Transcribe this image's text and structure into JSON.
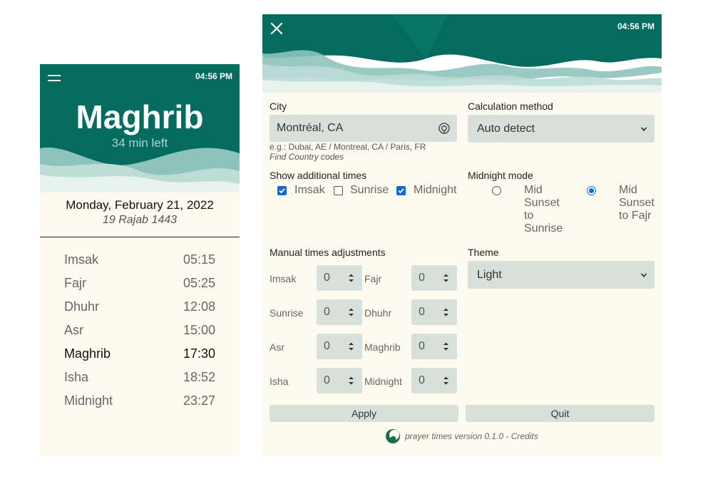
{
  "left_panel": {
    "time": "04:56 PM",
    "current_prayer": "Maghrib",
    "time_left": "34 min left",
    "gregorian_date": "Monday, February 21, 2022",
    "hijri_date": "19 Rajab 1443",
    "prayers": [
      {
        "name": "Imsak",
        "time": "05:15"
      },
      {
        "name": "Fajr",
        "time": "05:25"
      },
      {
        "name": "Dhuhr",
        "time": "12:08"
      },
      {
        "name": "Asr",
        "time": "15:00"
      },
      {
        "name": "Maghrib",
        "time": "17:30"
      },
      {
        "name": "Isha",
        "time": "18:52"
      },
      {
        "name": "Midnight",
        "time": "23:27"
      }
    ],
    "active_prayer": "Maghrib",
    "icons": [
      "menu-icon"
    ]
  },
  "settings": {
    "time": "04:56 PM",
    "city": {
      "label": "City",
      "value": "Montréal, CA",
      "hint": "e.g.: Dubai, AE / Montreal, CA / Paris, FR",
      "link": "Find Country codes"
    },
    "calculation_method": {
      "label": "Calculation method",
      "value": "Auto detect"
    },
    "additional_times": {
      "label": "Show additional times",
      "options": [
        {
          "label": "Imsak",
          "checked": true
        },
        {
          "label": "Sunrise",
          "checked": false
        },
        {
          "label": "Midnight",
          "checked": true
        }
      ]
    },
    "midnight_mode": {
      "label": "Midnight mode",
      "options": [
        {
          "label": "Mid Sunset to Sunrise",
          "selected": false
        },
        {
          "label": "Mid Sunset to Fajr",
          "selected": true
        }
      ]
    },
    "adjustments": {
      "label": "Manual times adjustments",
      "items": [
        {
          "label": "Imsak",
          "value": "0"
        },
        {
          "label": "Fajr",
          "value": "0"
        },
        {
          "label": "Sunrise",
          "value": "0"
        },
        {
          "label": "Dhuhr",
          "value": "0"
        },
        {
          "label": "Asr",
          "value": "0"
        },
        {
          "label": "Maghrib",
          "value": "0"
        },
        {
          "label": "Isha",
          "value": "0"
        },
        {
          "label": "Midnight",
          "value": "0"
        }
      ]
    },
    "theme": {
      "label": "Theme",
      "value": "Light"
    },
    "buttons": {
      "apply": "Apply",
      "quit": "Quit"
    },
    "footer": {
      "text": "prayer times version 0.1.0 - ",
      "credits": "Credits"
    },
    "icons": [
      "close-icon",
      "locate-icon",
      "chevron-down-icon",
      "app-logo-icon"
    ]
  },
  "colors": {
    "header_green": "#036b60",
    "panel_cream": "#fdfaf0",
    "field_gray": "#d8e0dc",
    "accent_blue": "#0b6bd6"
  }
}
